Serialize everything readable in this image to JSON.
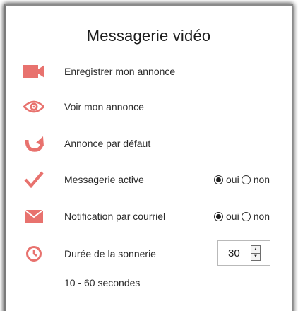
{
  "header": {
    "title": "Messagerie vidéo"
  },
  "colors": {
    "icon_accent": "#e8726e"
  },
  "items": [
    {
      "icon": "video-camera-icon",
      "label": "Enregistrer mon annonce"
    },
    {
      "icon": "eye-icon",
      "label": "Voir mon annonce"
    },
    {
      "icon": "undo-arrow-icon",
      "label": "Annonce par défaut"
    },
    {
      "icon": "checkmark-icon",
      "label": "Messagerie active"
    },
    {
      "icon": "envelope-icon",
      "label": "Notification par courriel"
    },
    {
      "icon": "clock-icon",
      "label": "Durée de la sonnerie"
    }
  ],
  "messagerie_active": {
    "yes_label": "oui",
    "no_label": "non",
    "selected": "oui"
  },
  "notification": {
    "yes_label": "oui",
    "no_label": "non",
    "selected": "oui"
  },
  "ring_duration": {
    "value": "30",
    "hint": "10 - 60 secondes"
  }
}
